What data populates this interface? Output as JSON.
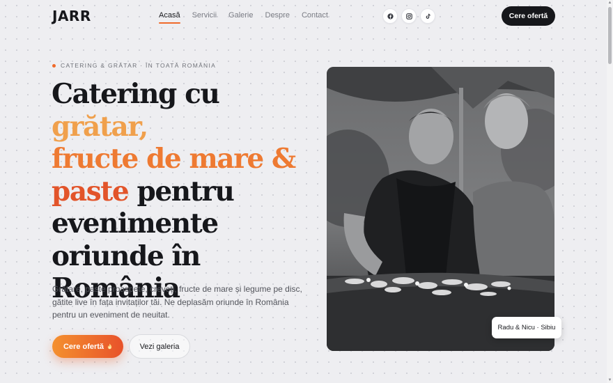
{
  "brand": {
    "logo": "JARR",
    "accent": "#ef6a2a"
  },
  "nav": {
    "items": [
      {
        "label": "Acasă",
        "active": true
      },
      {
        "label": "Servicii",
        "active": false
      },
      {
        "label": "Galerie",
        "active": false
      },
      {
        "label": "Despre",
        "active": false
      },
      {
        "label": "Contact",
        "active": false
      }
    ]
  },
  "socials": [
    {
      "icon": "facebook-icon"
    },
    {
      "icon": "instagram-icon"
    },
    {
      "icon": "tiktok-icon"
    }
  ],
  "header": {
    "cta_label": "Cere ofertă"
  },
  "hero": {
    "eyebrow": "CATERING & GRĂTAR · ÎN TOATĂ ROMÂNIA",
    "headline": {
      "part1": "Catering cu ",
      "highlight1": "grătar,",
      "highlight2": "fructe de mare &",
      "highlight3": "paste",
      "part2": " pentru evenimente oriunde în România"
    },
    "lead": "Grătare, paste proaspete, creveți, fructe de mare și legume pe disc, gătite live în fața invitaților tăi. Ne deplasăm oriunde în România pentru un eveniment de neuitat.",
    "primary_cta": "Cere ofertă",
    "primary_cta_icon": "flame-icon",
    "secondary_cta": "Vezi galeria",
    "photo_caption": "Radu & Nicu · Sibiu"
  }
}
